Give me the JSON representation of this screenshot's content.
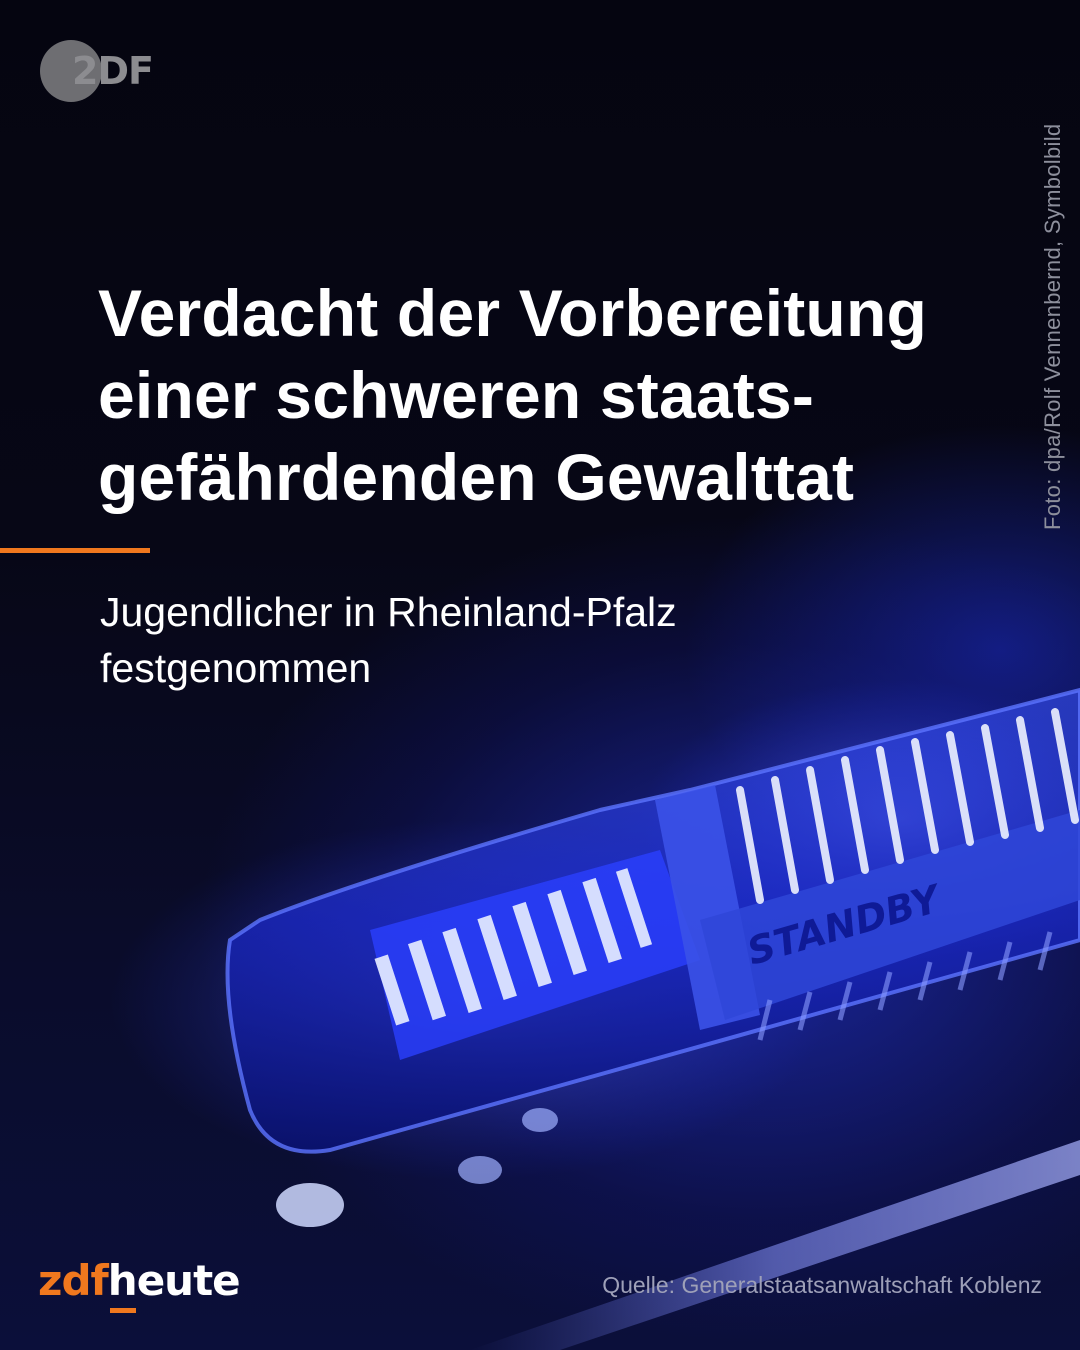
{
  "logo": {
    "text": "2DF"
  },
  "photo": {
    "label_text": "STANDBY",
    "accent_color": "#2a3cff"
  },
  "photo_credit": "Foto: dpa/Rolf Vennenbernd, Symbolbild",
  "headline": {
    "lines": [
      "Verdacht der Vorbereitung",
      "einer schweren staats-",
      "gefährdenden Gewalttat"
    ]
  },
  "subline": {
    "lines": [
      "Jugendlicher in Rheinland-Pfalz",
      "festgenommen"
    ]
  },
  "brand": {
    "part1": "zdf",
    "part2": "heute",
    "color": "#f0781e"
  },
  "source": "Quelle: Generalstaatsanwaltschaft Koblenz"
}
